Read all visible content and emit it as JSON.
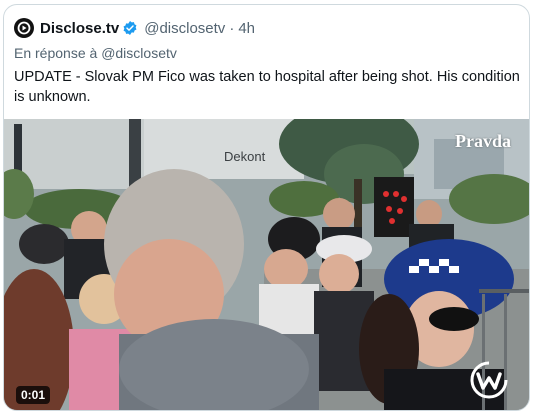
{
  "tweet": {
    "author_name": "Disclose.tv",
    "author_handle": "@disclosetv",
    "separator": "·",
    "time": "4h",
    "reply_prefix": "En réponse à",
    "reply_handle": "@disclosetv",
    "text": "UPDATE - Slovak PM Fico was taken to hospital after being shot. His condition is unknown."
  },
  "video": {
    "duration": "0:01",
    "watermark": "Pravda",
    "store_sign": "Dekont"
  },
  "icons": {
    "avatar": "disclose-logo-icon",
    "verified": "verified-badge-icon",
    "watermark_logo": "w-logo-icon"
  },
  "colors": {
    "text": "#0f1419",
    "secondary": "#536471",
    "verified_blue": "#1d9bf0",
    "border": "#cfd9de"
  }
}
